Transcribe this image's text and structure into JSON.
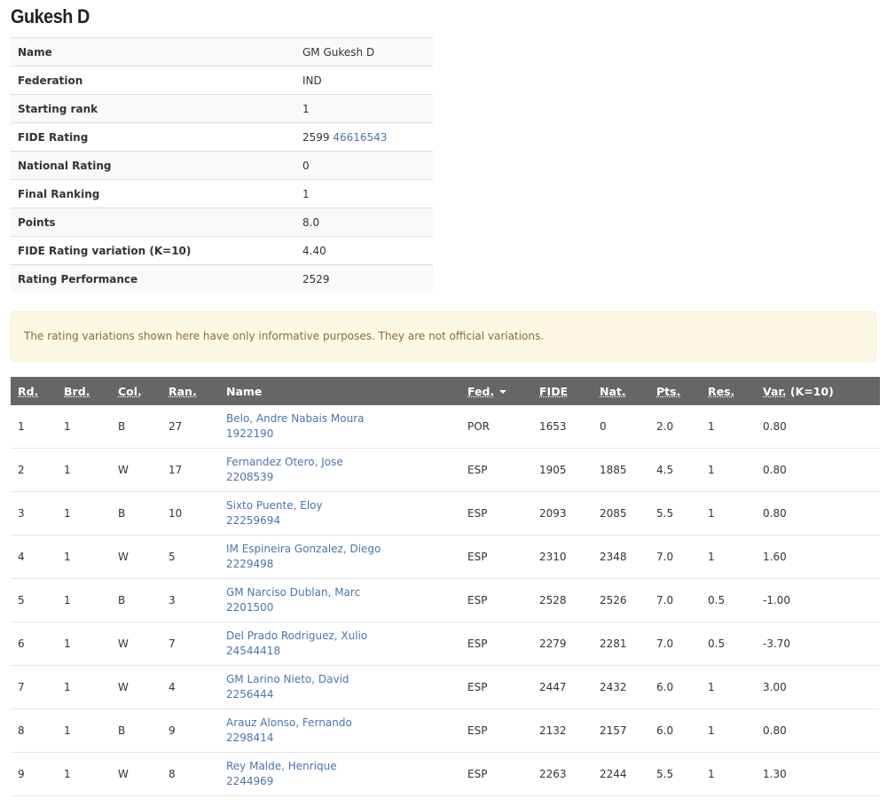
{
  "player": {
    "title": "Gukesh D"
  },
  "info_rows": [
    {
      "label": "Name",
      "value": "GM Gukesh D",
      "link": ""
    },
    {
      "label": "Federation",
      "value": "IND",
      "link": ""
    },
    {
      "label": "Starting rank",
      "value": "1",
      "link": ""
    },
    {
      "label": "FIDE Rating",
      "value": "2599",
      "link": "46616543"
    },
    {
      "label": "National Rating",
      "value": "0",
      "link": ""
    },
    {
      "label": "Final Ranking",
      "value": "1",
      "link": ""
    },
    {
      "label": "Points",
      "value": "8.0",
      "link": ""
    },
    {
      "label": "FIDE Rating variation (K=10)",
      "value": "4.40",
      "link": ""
    },
    {
      "label": "Rating Performance",
      "value": "2529",
      "link": ""
    }
  ],
  "notice": "The rating variations shown here have only informative purposes. They are not official variations.",
  "table": {
    "headers": {
      "rd": "Rd.",
      "brd": "Brd.",
      "col": "Col.",
      "ran": "Ran.",
      "name": "Name",
      "fed": "Fed.",
      "fide": "FIDE",
      "nat": "Nat.",
      "pts": "Pts.",
      "res": "Res.",
      "var_label": "Var.",
      "var_k": " (K=10)"
    },
    "rows": [
      {
        "rd": "1",
        "brd": "1",
        "col": "B",
        "ran": "27",
        "name": "Belo, Andre Nabais Moura",
        "id": "1922190",
        "fed": "POR",
        "fide": "1653",
        "nat": "0",
        "pts": "2.0",
        "res": "1",
        "var": "0.80"
      },
      {
        "rd": "2",
        "brd": "1",
        "col": "W",
        "ran": "17",
        "name": "Fernandez Otero, Jose",
        "id": "2208539",
        "fed": "ESP",
        "fide": "1905",
        "nat": "1885",
        "pts": "4.5",
        "res": "1",
        "var": "0.80"
      },
      {
        "rd": "3",
        "brd": "1",
        "col": "B",
        "ran": "10",
        "name": "Sixto Puente, Eloy",
        "id": "22259694",
        "fed": "ESP",
        "fide": "2093",
        "nat": "2085",
        "pts": "5.5",
        "res": "1",
        "var": "0.80"
      },
      {
        "rd": "4",
        "brd": "1",
        "col": "W",
        "ran": "5",
        "name": "IM Espineira Gonzalez, Diego",
        "id": "2229498",
        "fed": "ESP",
        "fide": "2310",
        "nat": "2348",
        "pts": "7.0",
        "res": "1",
        "var": "1.60"
      },
      {
        "rd": "5",
        "brd": "1",
        "col": "B",
        "ran": "3",
        "name": "GM Narciso Dublan, Marc",
        "id": "2201500",
        "fed": "ESP",
        "fide": "2528",
        "nat": "2526",
        "pts": "7.0",
        "res": "0.5",
        "var": "-1.00"
      },
      {
        "rd": "6",
        "brd": "1",
        "col": "W",
        "ran": "7",
        "name": "Del Prado Rodriguez, Xulio",
        "id": "24544418",
        "fed": "ESP",
        "fide": "2279",
        "nat": "2281",
        "pts": "7.0",
        "res": "0.5",
        "var": "-3.70"
      },
      {
        "rd": "7",
        "brd": "1",
        "col": "W",
        "ran": "4",
        "name": "GM Larino Nieto, David",
        "id": "2256444",
        "fed": "ESP",
        "fide": "2447",
        "nat": "2432",
        "pts": "6.0",
        "res": "1",
        "var": "3.00"
      },
      {
        "rd": "8",
        "brd": "1",
        "col": "B",
        "ran": "9",
        "name": "Arauz Alonso, Fernando",
        "id": "2298414",
        "fed": "ESP",
        "fide": "2132",
        "nat": "2157",
        "pts": "6.0",
        "res": "1",
        "var": "0.80"
      },
      {
        "rd": "9",
        "brd": "1",
        "col": "W",
        "ran": "8",
        "name": "Rey Malde, Henrique",
        "id": "2244969",
        "fed": "ESP",
        "fide": "2263",
        "nat": "2244",
        "pts": "5.5",
        "res": "1",
        "var": "1.30"
      }
    ]
  }
}
